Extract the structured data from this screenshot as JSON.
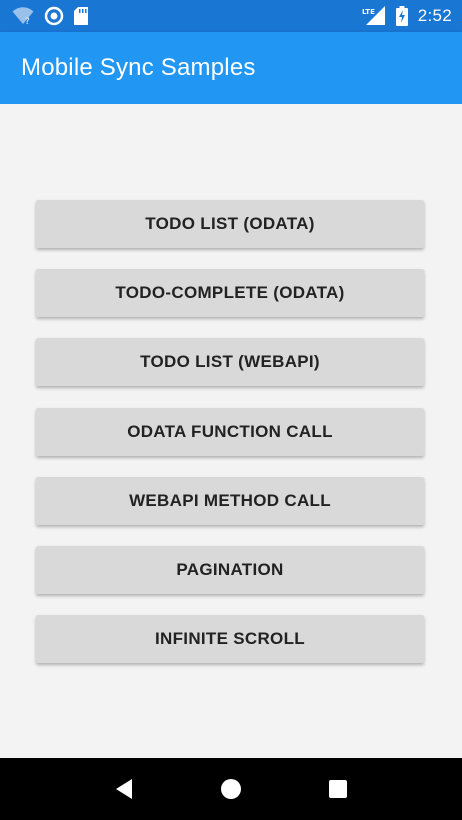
{
  "status_bar": {
    "time": "2:52",
    "network_label": "LTE",
    "icons": [
      "wifi-icon",
      "sync-circle-icon",
      "sd-card-icon",
      "lte-signal-icon",
      "battery-charging-icon"
    ]
  },
  "app_bar": {
    "title": "Mobile Sync Samples",
    "color": "#2196f3",
    "status_color": "#1976d2"
  },
  "buttons": [
    {
      "label": "TODO LIST (ODATA)"
    },
    {
      "label": "TODO-COMPLETE (ODATA)"
    },
    {
      "label": "TODO LIST (WEBAPI)"
    },
    {
      "label": "ODATA FUNCTION CALL"
    },
    {
      "label": "WEBAPI METHOD CALL"
    },
    {
      "label": "PAGINATION"
    },
    {
      "label": "INFINITE SCROLL"
    }
  ],
  "nav_bar": {
    "icons": [
      "back-triangle-icon",
      "home-circle-icon",
      "recents-square-icon"
    ]
  }
}
